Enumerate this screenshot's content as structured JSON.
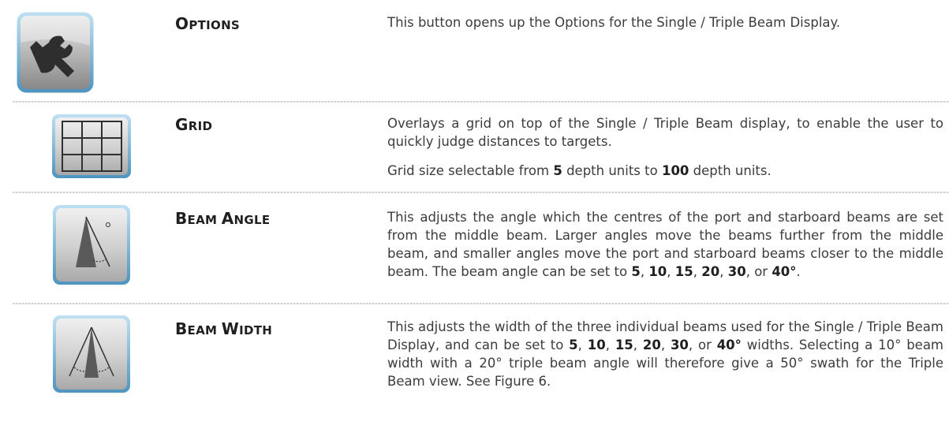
{
  "rows": [
    {
      "title_first": "O",
      "title_rest": "ptions",
      "icon": "wrench-icon",
      "description": "This button opens up the Options for the Single / Triple Beam Display."
    },
    {
      "title_first": "G",
      "title_rest": "rid",
      "icon": "grid-icon",
      "description_1": "Overlays a grid on top of the Single / Triple Beam display, to enable the user to quickly judge distances to targets.",
      "description_2_parts": [
        "Grid size selectable from ",
        "5",
        " depth units to ",
        "100",
        " depth units."
      ]
    },
    {
      "title_word1_first": "B",
      "title_word1_rest": "eam",
      "title_word2_first": "A",
      "title_word2_rest": "ngle",
      "icon": "beam-angle-icon",
      "description_parts": [
        "This adjusts the angle which the centres of the port and starboard beams are set from the middle beam. Larger angles move the beams further from the middle beam, and smaller angles move the port and starboard beams closer to the middle beam. The beam angle can be set to ",
        "5",
        ", ",
        "10",
        ", ",
        "15",
        ", ",
        "20",
        ", ",
        "30",
        ", or ",
        "40°",
        "."
      ]
    },
    {
      "title_word1_first": "B",
      "title_word1_rest": "eam",
      "title_word2_first": "W",
      "title_word2_rest": "idth",
      "icon": "beam-width-icon",
      "description_parts": [
        "This adjusts the width of the three individual beams used for the Single / Triple Beam Display, and can be set to ",
        "5",
        ", ",
        "10",
        ", ",
        "15",
        ", ",
        "20",
        ", ",
        "30",
        ", or ",
        "40°",
        " widths. Selecting a 10° beam width with a 20° triple beam angle will therefore give a 50° swath for the Triple Beam view. See Figure 6."
      ]
    }
  ]
}
